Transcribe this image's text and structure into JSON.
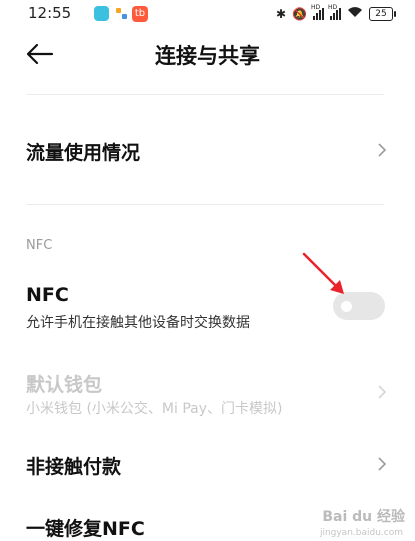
{
  "status_bar": {
    "time": "12:55",
    "taobao_badge": "tb",
    "battery": "25",
    "network_labels": [
      "HD",
      "HD"
    ]
  },
  "header": {
    "title": "连接与共享"
  },
  "rows": {
    "data_usage": {
      "title": "流量使用情况"
    },
    "nfc_section_label": "NFC",
    "nfc": {
      "title": "NFC",
      "subtitle": "允许手机在接触其他设备时交换数据",
      "enabled": false
    },
    "default_wallet": {
      "title": "默认钱包",
      "subtitle": "小米钱包 (小米公交、Mi Pay、门卡模拟)"
    },
    "contactless_payment": {
      "title": "非接触付款"
    },
    "repair_nfc": {
      "title": "一键修复NFC"
    }
  },
  "watermark": {
    "brand": "Bai du 经验",
    "url": "jingyan.baidu.com"
  },
  "colors": {
    "annotation_arrow": "#e8232b",
    "toggle_off": "#e6e6e6",
    "disabled_text": "#c8c8c8"
  }
}
